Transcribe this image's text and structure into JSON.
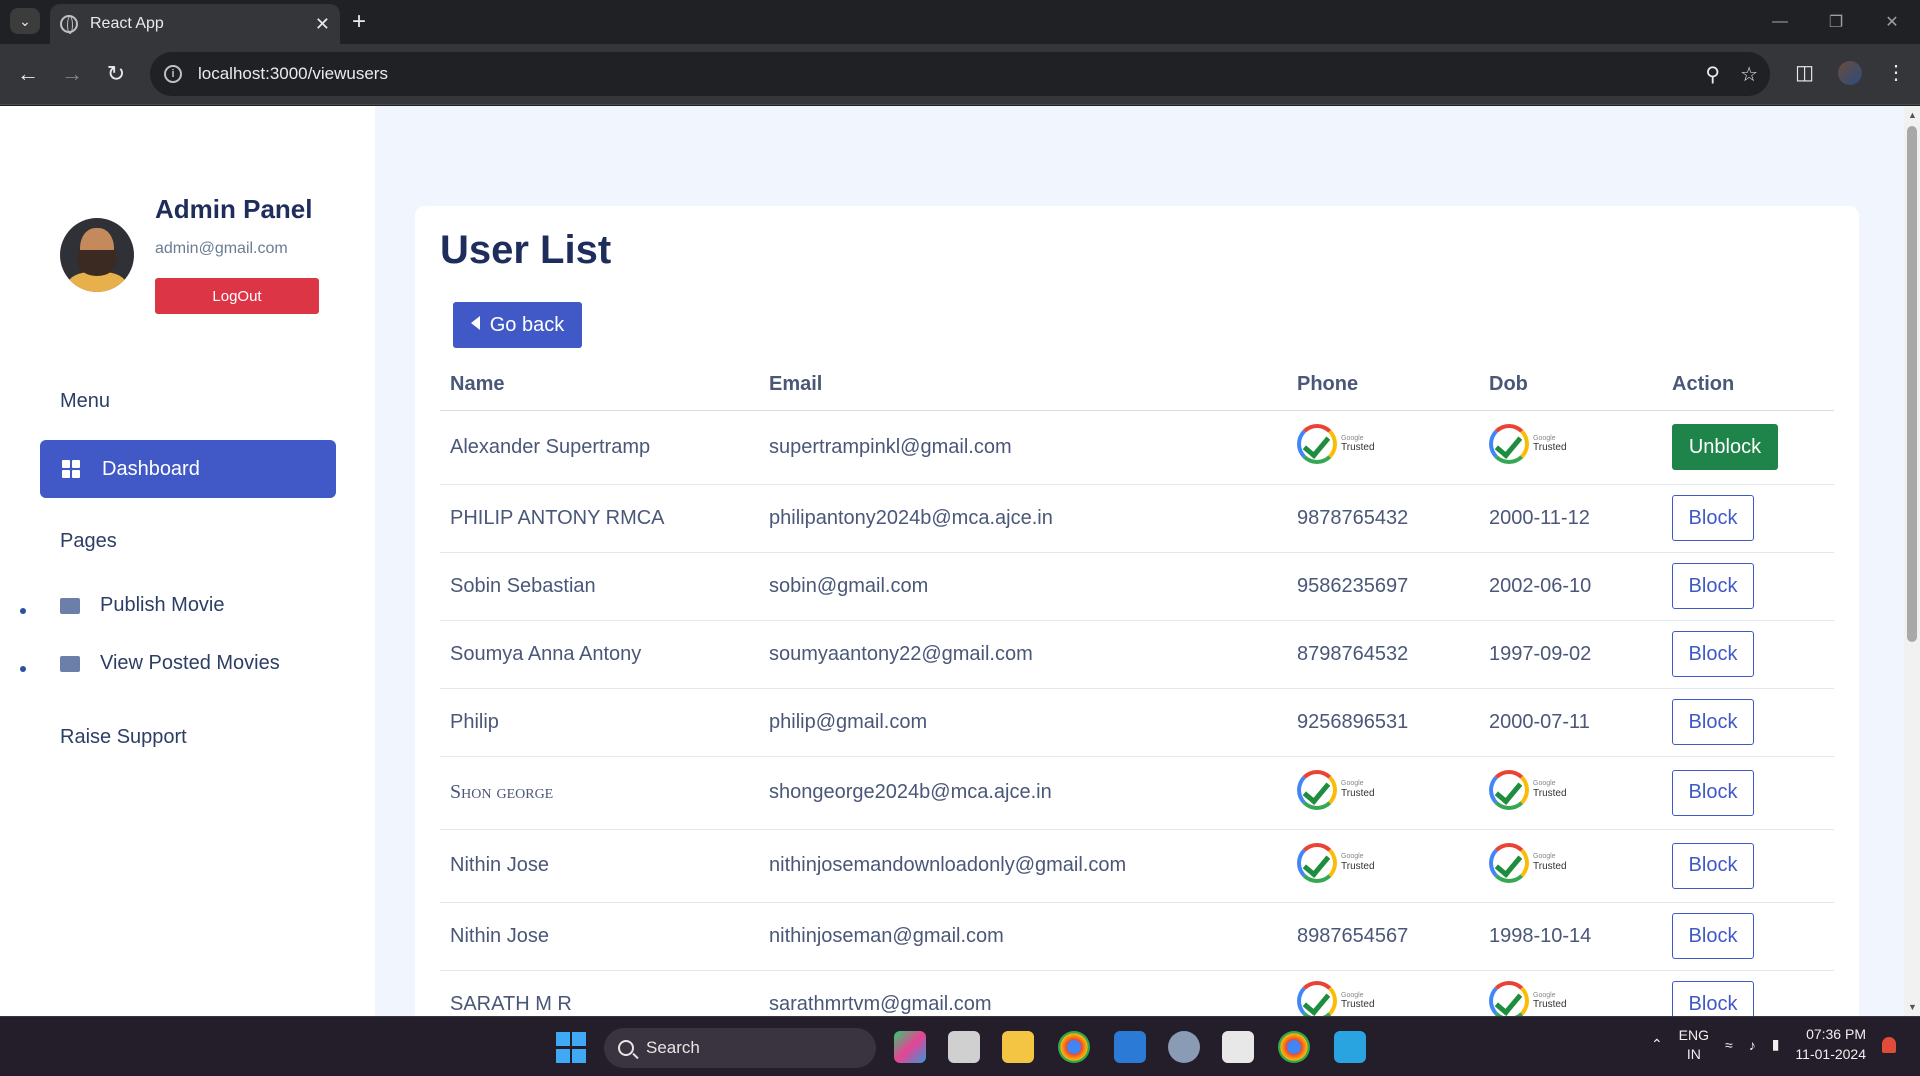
{
  "browser": {
    "tab_title": "React App",
    "url": "localhost:3000/viewusers"
  },
  "sidebar": {
    "admin_title": "Admin Panel",
    "admin_email": "admin@gmail.com",
    "logout_label": "LogOut",
    "menu_label": "Menu",
    "dashboard_label": "Dashboard",
    "pages_label": "Pages",
    "publish_movie_label": "Publish Movie",
    "view_posted_label": "View Posted Movies",
    "raise_support_label": "Raise Support"
  },
  "main": {
    "title": "User List",
    "go_back_label": "Go back",
    "columns": [
      "Name",
      "Email",
      "Phone",
      "Dob",
      "Action"
    ],
    "badge": {
      "google": "Google",
      "trusted": "Trusted"
    },
    "rows": [
      {
        "name": "Alexander Supertramp",
        "email": "supertrampinkl@gmail.com",
        "phone": "",
        "dob": "",
        "action": "Unblock"
      },
      {
        "name": "PHILIP ANTONY RMCA",
        "email": "philipantony2024b@mca.ajce.in",
        "phone": "9878765432",
        "dob": "2000-11-12",
        "action": "Block"
      },
      {
        "name": "Sobin Sebastian",
        "email": "sobin@gmail.com",
        "phone": "9586235697",
        "dob": "2002-06-10",
        "action": "Block"
      },
      {
        "name": "Soumya Anna Antony",
        "email": "soumyaantony22@gmail.com",
        "phone": "8798764532",
        "dob": "1997-09-02",
        "action": "Block"
      },
      {
        "name": "Philip",
        "email": "philip@gmail.com",
        "phone": "9256896531",
        "dob": "2000-07-11",
        "action": "Block"
      },
      {
        "name": "Shon george",
        "email": "shongeorge2024b@mca.ajce.in",
        "phone": "",
        "dob": "",
        "action": "Block"
      },
      {
        "name": "Nithin Jose",
        "email": "nithinjosemandownloadonly@gmail.com",
        "phone": "",
        "dob": "",
        "action": "Block"
      },
      {
        "name": "Nithin Jose",
        "email": "nithinjoseman@gmail.com",
        "phone": "8987654567",
        "dob": "1998-10-14",
        "action": "Block"
      },
      {
        "name": "SARATH M R",
        "email": "sarathmrtvm@gmail.com",
        "phone": "",
        "dob": "",
        "action": "Block"
      }
    ]
  },
  "taskbar": {
    "search_label": "Search",
    "lang_top": "ENG",
    "lang_bottom": "IN",
    "time": "07:36 PM",
    "date": "11-01-2024"
  },
  "colors": {
    "accent": "#4059c6",
    "danger": "#dc3545",
    "success": "#1e8449",
    "page_bg": "#f1f5fd",
    "heading": "#1e2d5c"
  }
}
